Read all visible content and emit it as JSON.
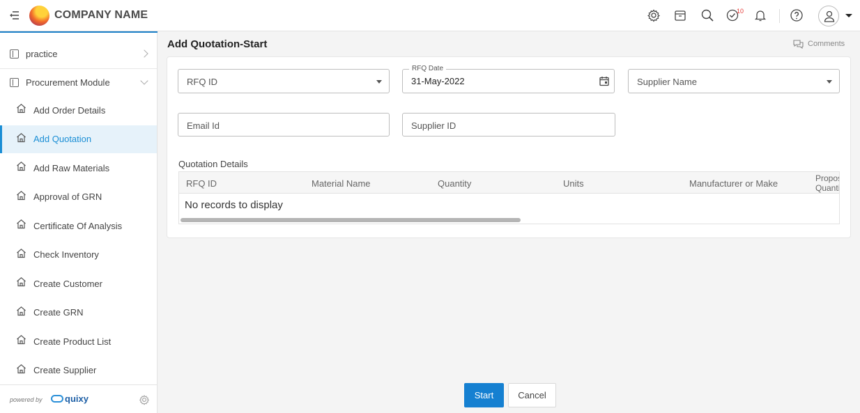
{
  "header": {
    "company_name": "COMPANY NAME",
    "task_badge_count": "10",
    "icons": [
      "menu-toggle-icon",
      "settings-icon",
      "store-icon",
      "search-icon",
      "tasks-check-icon",
      "bell-icon",
      "help-icon",
      "user-icon"
    ]
  },
  "sidebar": {
    "modules": [
      {
        "label": "practice",
        "icon": "module-icon"
      },
      {
        "label": "Procurement Module",
        "icon": "module-icon"
      }
    ],
    "items": [
      {
        "label": "Add Order Details"
      },
      {
        "label": "Add Quotation",
        "active": true
      },
      {
        "label": "Add Raw Materials"
      },
      {
        "label": "Approval of GRN"
      },
      {
        "label": "Certificate Of Analysis"
      },
      {
        "label": "Check Inventory"
      },
      {
        "label": "Create Customer"
      },
      {
        "label": "Create GRN"
      },
      {
        "label": "Create Product List"
      },
      {
        "label": "Create Supplier"
      }
    ],
    "footer": {
      "powered_by": "powered by",
      "brand": "quixy"
    }
  },
  "main": {
    "title": "Add Quotation-Start",
    "comments_label": "Comments",
    "form": {
      "rfq_id_placeholder": "RFQ ID",
      "rfq_date_label": "RFQ Date",
      "rfq_date_value": "31-May-2022",
      "supplier_name_placeholder": "Supplier Name",
      "email_placeholder": "Email Id",
      "supplier_id_placeholder": "Supplier ID"
    },
    "quotation_details": {
      "label": "Quotation Details",
      "columns": [
        "RFQ ID",
        "Material Name",
        "Quantity",
        "Units",
        "Manufacturer or Make",
        "Proposed Quantity"
      ],
      "empty_text": "No records to display"
    },
    "buttons": {
      "start": "Start",
      "cancel": "Cancel"
    }
  },
  "colors": {
    "accent": "#1580d1",
    "active_bg": "#e6f2fa",
    "badge": "#e53935"
  }
}
